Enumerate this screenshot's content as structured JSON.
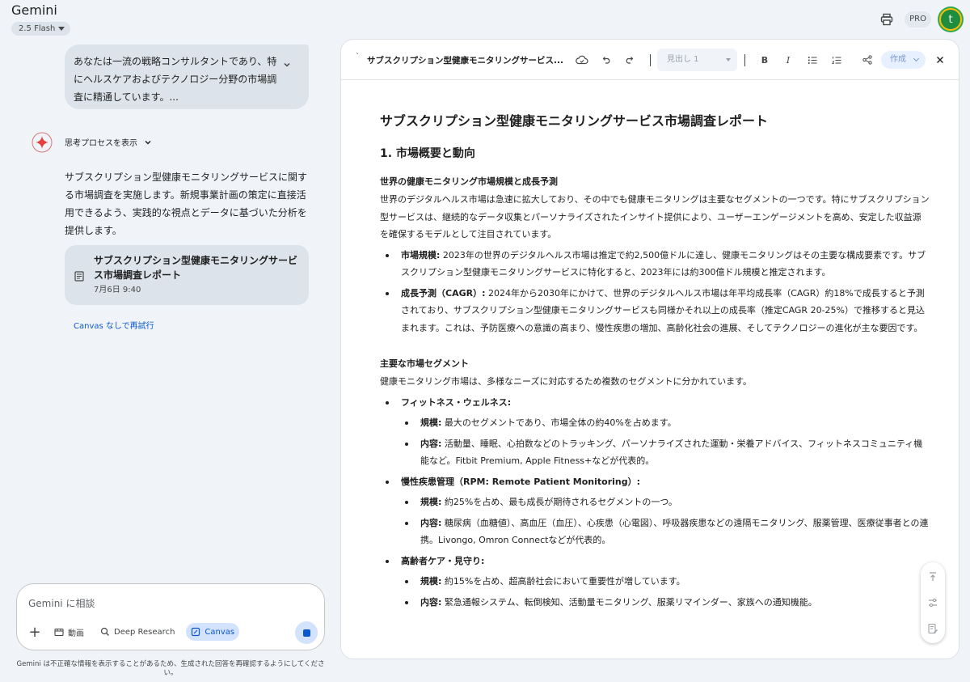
{
  "app": {
    "brand": "Gemini",
    "model": "2.5 Flash",
    "pro_badge": "PRO",
    "avatar_initial": "t"
  },
  "chat": {
    "user_message": "あなたは一流の戦略コンサルタントであり、特にヘルスケアおよびテクノロジー分野の市場調査に精通しています。...",
    "thinking_label": "思考プロセスを表示",
    "reply_text": "サブスクリプション型健康モニタリングサービスに関する市場調査を実施します。新規事業計画の策定に直接活用できるよう、実践的な視点とデータに基づいた分析を提供します。",
    "doc_card": {
      "title": "サブスクリプション型健康モニタリングサービス市場調査レポート",
      "date": "7月6日 9:40"
    },
    "retry_label": "Canvas なしで再試行"
  },
  "composer": {
    "placeholder": "Gemini に相談",
    "tools": [
      "動画",
      "Deep Research",
      "Canvas"
    ],
    "disclaimer": "Gemini は不正確な情報を表示することがあるため、生成された回答を再確認するようにしてください。"
  },
  "canvas": {
    "toolbar": {
      "doc_title": "サブスクリプション型健康モニタリングサービス...",
      "heading_select": "見出し 1",
      "compose_label": "作成"
    },
    "doc": {
      "title": "サブスクリプション型健康モニタリングサービス市場調査レポート",
      "section1": "1. 市場概要と動向",
      "sub1": "世界の健康モニタリング市場規模と成長予測",
      "para1": "世界のデジタルヘルス市場は急速に拡大しており、その中でも健康モニタリングは主要なセグメントの一つです。特にサブスクリプション型サービスは、継続的なデータ収集とパーソナライズされたインサイト提供により、ユーザーエンゲージメントを高め、安定した収益源を確保するモデルとして注目されています。",
      "b1_label": "市場規模:",
      "b1_text": " 2023年の世界のデジタルヘルス市場は推定で約2,500億ドルに達し、健康モニタリングはその主要な構成要素です。サブスクリプション型健康モニタリングサービスに特化すると、2023年には約300億ドル規模と推定されます。",
      "b2_label": "成長予測（CAGR）:",
      "b2_text": " 2024年から2030年にかけて、世界のデジタルヘルス市場は年平均成長率（CAGR）約18%で成長すると予測されており、サブスクリプション型健康モニタリングサービスも同様かそれ以上の成長率（推定CAGR 20-25%）で推移すると見込まれます。これは、予防医療への意識の高まり、慢性疾患の増加、高齢化社会の進展、そしてテクノロジーの進化が主な要因です。",
      "sub2": "主要な市場セグメント",
      "para2": "健康モニタリング市場は、多様なニーズに対応するため複数のセグメントに分かれています。",
      "seg1": "フィットネス・ウェルネス:",
      "seg1_scale_label": "規模:",
      "seg1_scale": " 最大のセグメントであり、市場全体の約40%を占めます。",
      "seg1_content_label": "内容:",
      "seg1_content": " 活動量、睡眠、心拍数などのトラッキング、パーソナライズされた運動・栄養アドバイス、フィットネスコミュニティ機能など。Fitbit Premium, Apple Fitness+などが代表的。",
      "seg2": "慢性疾患管理（RPM: Remote Patient Monitoring）:",
      "seg2_scale_label": "規模:",
      "seg2_scale": " 約25%を占め、最も成長が期待されるセグメントの一つ。",
      "seg2_content_label": "内容:",
      "seg2_content": " 糖尿病（血糖値）、高血圧（血圧）、心疾患（心電図）、呼吸器疾患などの遠隔モニタリング、服薬管理、医療従事者との連携。Livongo, Omron Connectなどが代表的。",
      "seg3": "高齢者ケア・見守り:",
      "seg3_scale_label": "規模:",
      "seg3_scale": " 約15%を占め、超高齢社会において重要性が増しています。",
      "seg3_content_label": "内容:",
      "seg3_content": " 緊急通報システム、転倒検知、活動量モニタリング、服薬リマインダー、家族への通知機能。"
    }
  },
  "colors": {
    "background": "#f0f4f9",
    "bubble": "#dde3ea",
    "link": "#0b57d0",
    "accent_light": "#d3e3fd"
  }
}
